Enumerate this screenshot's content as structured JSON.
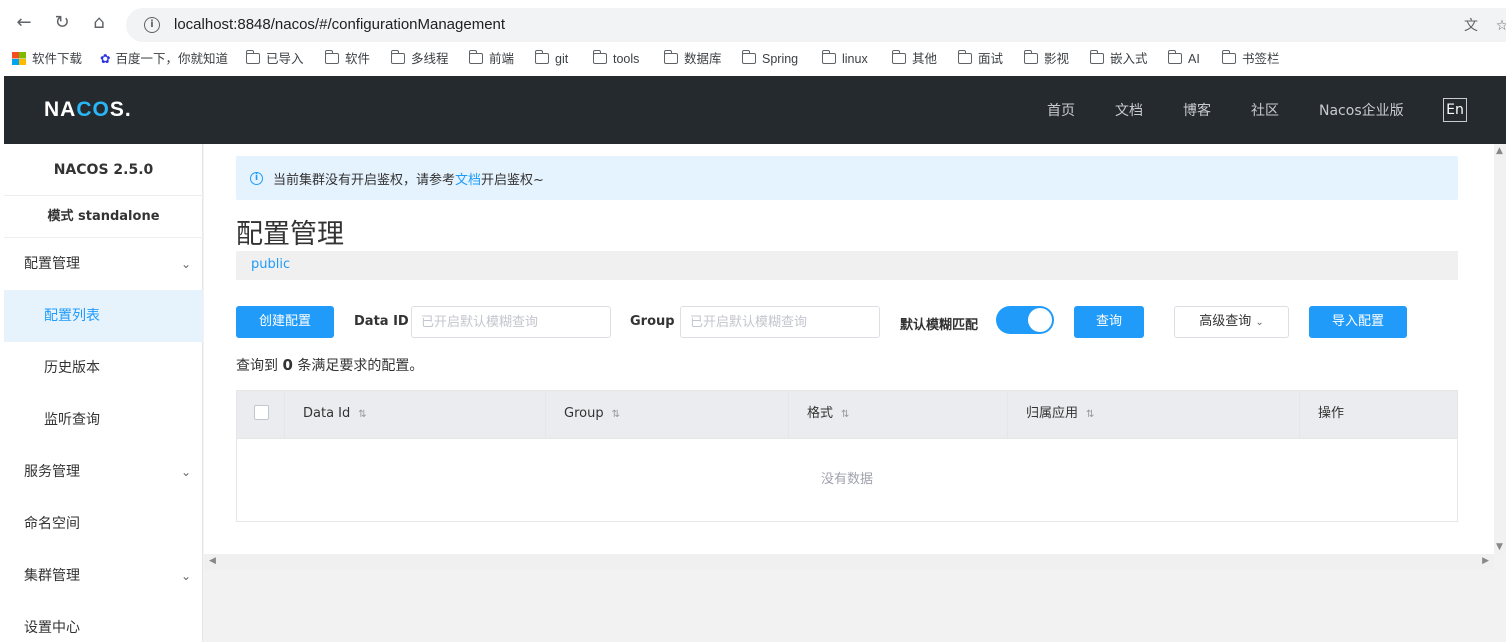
{
  "browser": {
    "url": "localhost:8848/nacos/#/configurationManagement",
    "bookmarks": [
      "软件下载",
      "百度一下，你就知道",
      "已导入",
      "软件",
      "多线程",
      "前端",
      "git",
      "tools",
      "数据库",
      "Spring",
      "linux",
      "其他",
      "面试",
      "影视",
      "嵌入式",
      "AI",
      "书签栏"
    ]
  },
  "header": {
    "logo_left": "NA",
    "logo_mid": "CO",
    "logo_right": "S.",
    "nav": [
      "首页",
      "文档",
      "博客",
      "社区",
      "Nacos企业版"
    ],
    "lang": "En"
  },
  "sidebar": {
    "version": "NACOS 2.5.0",
    "mode": "模式 standalone",
    "items": [
      {
        "label": "配置管理"
      },
      {
        "label": "配置列表"
      },
      {
        "label": "历史版本"
      },
      {
        "label": "监听查询"
      },
      {
        "label": "服务管理"
      },
      {
        "label": "命名空间"
      },
      {
        "label": "集群管理"
      },
      {
        "label": "设置中心"
      }
    ]
  },
  "notice": {
    "before": "当前集群没有开启鉴权，请参考",
    "link": "文档",
    "after": "开启鉴权~"
  },
  "page": {
    "title": "配置管理",
    "namespace": "public"
  },
  "toolbar": {
    "create": "创建配置",
    "dataid_label": "Data ID",
    "dataid_placeholder": "已开启默认模糊查询",
    "group_label": "Group",
    "group_placeholder": "已开启默认模糊查询",
    "fuzzy_label": "默认模糊匹配",
    "fuzzy_on": true,
    "query": "查询",
    "advanced": "高级查询",
    "import": "导入配置"
  },
  "result": {
    "prefix": "查询到",
    "count": "0",
    "suffix": "条满足要求的配置。"
  },
  "table": {
    "columns": [
      "Data Id",
      "Group",
      "格式",
      "归属应用",
      "操作"
    ],
    "empty": "没有数据"
  }
}
